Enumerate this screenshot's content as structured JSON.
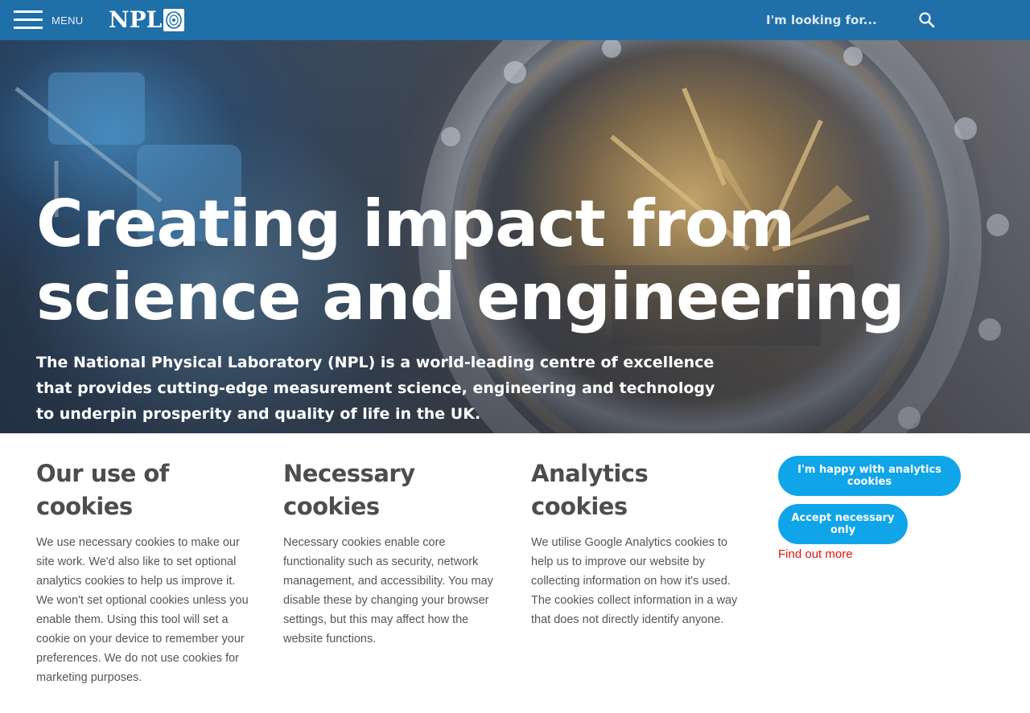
{
  "header": {
    "menu_label": "MENU",
    "logo_text": "NPL",
    "search_placeholder": "I'm looking for...",
    "brand_color": "#1f6fa8",
    "icons": [
      "hamburger-icon",
      "crest-icon",
      "search-icon"
    ]
  },
  "hero": {
    "title": "Creating impact from science and engineering",
    "description": "The National Physical Laboratory (NPL) is a world-leading centre of excellence that provides cutting-edge measurement science, engineering and technology to underpin prosperity and quality of life in the UK."
  },
  "cookies": {
    "usage": {
      "heading": "Our use of cookies",
      "text": "We use necessary cookies to make our site work. We'd also like to set optional analytics cookies to help us improve it. We won't set optional cookies unless you enable them. Using this tool will set a cookie on your device to remember your preferences. We do not use cookies for marketing purposes."
    },
    "necessary": {
      "heading": "Necessary cookies",
      "text": "Necessary cookies enable core functionality such as security, network management, and accessibility. You may disable these by changing your browser settings, but this may affect how the website functions."
    },
    "analytics": {
      "heading": "Analytics cookies",
      "text": "We utilise Google Analytics cookies to help us to improve our website by collecting information on how it's used. The cookies collect information in a way that does not directly identify anyone."
    },
    "buttons": {
      "analytics_label": "I'm happy with analytics cookies",
      "necessary_label": "Accept necessary only",
      "find_more_label": "Find out more"
    },
    "button_color": "#10a5e8",
    "link_color": "#e8120c"
  }
}
